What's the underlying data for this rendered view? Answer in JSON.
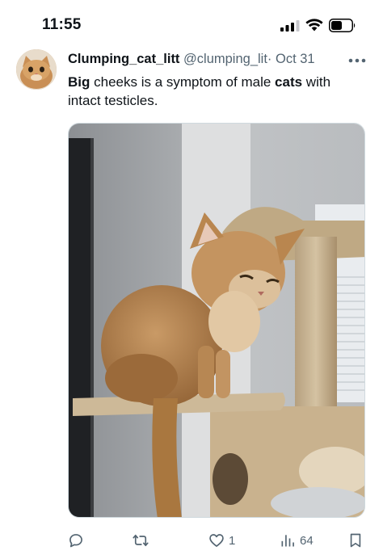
{
  "status_bar": {
    "time": "11:55",
    "signal_icon": "cellular-signal-icon",
    "wifi_icon": "wifi-icon",
    "battery_icon": "battery-icon"
  },
  "tweet": {
    "display_name": "Clumping_cat_litt",
    "handle": "@clumping_lit",
    "separator": "·",
    "date": "Oct 31",
    "more_icon": "more-horizontal-icon",
    "text": {
      "part1_bold": "Big",
      "part2": " cheeks is a symptom of male ",
      "part3_bold": "cats",
      "part4": " with intact testicles."
    },
    "media": {
      "kind": "photo",
      "subject": "orange cat sitting on cat tree"
    },
    "actions": {
      "reply": {
        "icon": "reply-icon",
        "count": ""
      },
      "retweet": {
        "icon": "retweet-icon",
        "count": ""
      },
      "like": {
        "icon": "heart-icon",
        "count": "1"
      },
      "views": {
        "icon": "views-icon",
        "count": "64"
      },
      "bookmark": {
        "icon": "bookmark-icon",
        "count": ""
      }
    }
  },
  "colors": {
    "text_primary": "#0f1419",
    "text_secondary": "#536471",
    "background": "#ffffff",
    "media_border": "#cfd9de"
  }
}
